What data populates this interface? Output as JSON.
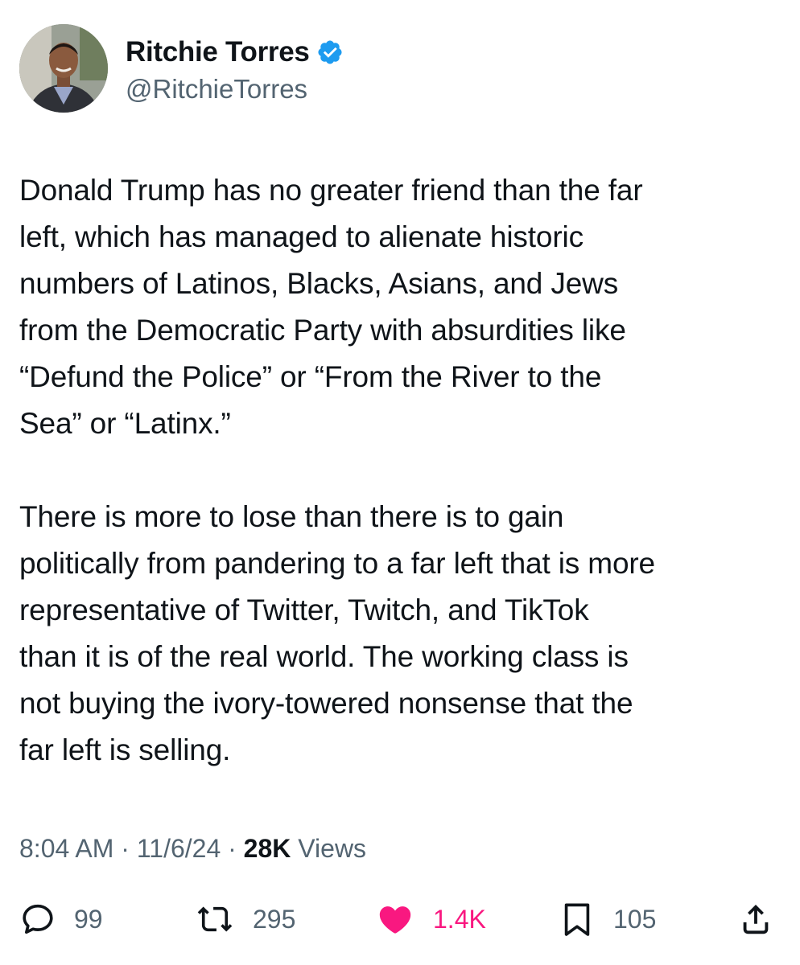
{
  "tweet": {
    "author": {
      "name": "Ritchie Torres",
      "handle": "@RitchieTorres",
      "verified": true
    },
    "paragraphs": [
      [
        "Donald Trump has no greater friend than the far",
        "left, which has managed to alienate historic",
        "numbers of Latinos, Blacks, Asians, and Jews",
        "from the Democratic Party with absurdities like",
        "“Defund the Police” or “From the River to the",
        "Sea” or “Latinx.”"
      ],
      [
        "There is more to lose than there is to gain",
        "politically from pandering to a far left that is more",
        "representative of Twitter, Twitch, and TikTok",
        "than it is of the real world.  The working class is",
        "not buying the ivory-towered nonsense that the",
        "far left is selling."
      ]
    ],
    "meta": {
      "time": "8:04 AM",
      "separator": "·",
      "date": "11/6/24",
      "views_count": "28K",
      "views_label": "Views"
    },
    "actions": {
      "replies": "99",
      "reposts": "295",
      "likes": "1.4K",
      "bookmarks": "105"
    }
  },
  "icons": {
    "reply": "reply-bubble-icon",
    "repost": "repost-arrows-icon",
    "like": "heart-icon",
    "bookmark": "bookmark-icon",
    "share": "share-upload-icon",
    "verified": "verified-badge-icon"
  },
  "colors": {
    "text": "#0f1419",
    "secondary": "#536471",
    "like": "#f91880",
    "verified": "#1d9bf0"
  }
}
